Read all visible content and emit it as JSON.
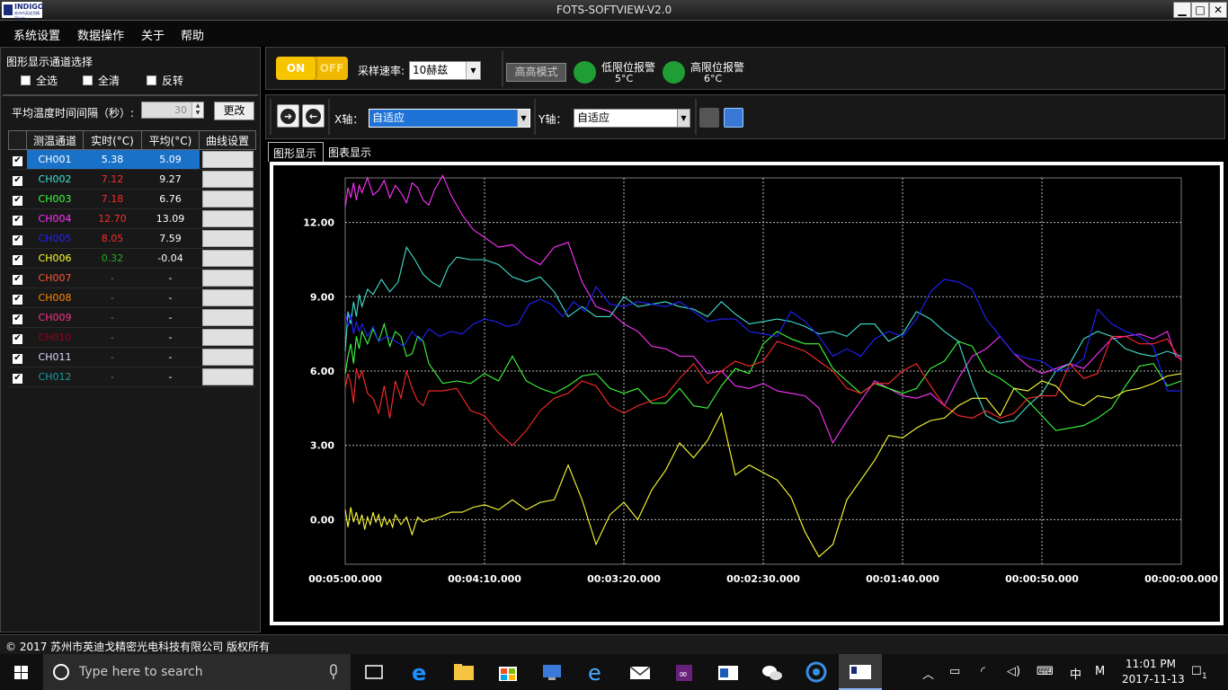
{
  "window": {
    "title": "FOTS-SOFTVIEW-V2.0",
    "logo_text": "INDIGO",
    "logo_sub": "苏州市英迪戈精密光电"
  },
  "menu": [
    "系统设置",
    "数据操作",
    "关于",
    "帮助"
  ],
  "left": {
    "channel_select_title": "图形显示通道选择",
    "options": [
      "全选",
      "全清",
      "反转"
    ],
    "interval_label": "平均温度时间间隔（秒）:",
    "interval_value": "30",
    "change_button": "更改",
    "table_headers": [
      "测温通道",
      "实时(°C)",
      "平均(°C)",
      "曲线设置"
    ],
    "channels": [
      {
        "name": "CH001",
        "rt": "5.38",
        "avg": "5.09",
        "color": "#ffffff",
        "rt_color": "#ffffff"
      },
      {
        "name": "CH002",
        "rt": "7.12",
        "avg": "9.27",
        "color": "#40e0d0",
        "rt_color": "#ff2a2a"
      },
      {
        "name": "CH003",
        "rt": "7.18",
        "avg": "6.76",
        "color": "#3cff3c",
        "rt_color": "#ff2a2a"
      },
      {
        "name": "CH004",
        "rt": "12.70",
        "avg": "13.09",
        "color": "#ff33ff",
        "rt_color": "#ff2a2a"
      },
      {
        "name": "CH005",
        "rt": "8.05",
        "avg": "7.59",
        "color": "#2222ff",
        "rt_color": "#ff2a2a"
      },
      {
        "name": "CH006",
        "rt": "0.32",
        "avg": "-0.04",
        "color": "#ffff33",
        "rt_color": "#22aa22"
      },
      {
        "name": "CH007",
        "rt": "-",
        "avg": "-",
        "color": "#ff5533",
        "rt_color": "#777777"
      },
      {
        "name": "CH008",
        "rt": "-",
        "avg": "-",
        "color": "#ff8800",
        "rt_color": "#777777"
      },
      {
        "name": "CH009",
        "rt": "-",
        "avg": "-",
        "color": "#ff3388",
        "rt_color": "#777777"
      },
      {
        "name": "CH010",
        "rt": "-",
        "avg": "-",
        "color": "#990022",
        "rt_color": "#777777"
      },
      {
        "name": "CH011",
        "rt": "-",
        "avg": "-",
        "color": "#ddddff",
        "rt_color": "#777777"
      },
      {
        "name": "CH012",
        "rt": "-",
        "avg": "-",
        "color": "#199999",
        "rt_color": "#777777"
      }
    ]
  },
  "controls": {
    "toggle_on": "ON",
    "toggle_off": "OFF",
    "rate_label": "采样速率:",
    "rate_value": "10赫兹",
    "high_speed_mode": "高高模式",
    "low_alarm_label": "低限位报警",
    "low_alarm_value": "5°C",
    "high_alarm_label": "高限位报警",
    "high_alarm_value": "6°C"
  },
  "chart_toolbar": {
    "x_axis_label": "X轴：",
    "x_axis_value": "自适应",
    "y_axis_label": "Y轴：",
    "y_axis_value": "自适应"
  },
  "tabs": [
    "图形显示",
    "图表显示"
  ],
  "chart_data": {
    "type": "line",
    "x_tick_labels": [
      "00:05:00.000",
      "00:04:10.000",
      "00:03:20.000",
      "00:02:30.000",
      "00:01:40.000",
      "00:00:50.000",
      "00:00:00.000"
    ],
    "y_tick_labels": [
      "0.00",
      "3.00",
      "6.00",
      "9.00",
      "12.00"
    ],
    "ylim": [
      -1.8,
      13.8
    ],
    "xlim": [
      300,
      0
    ],
    "grid": true,
    "series": [
      {
        "color": "#ff33ff",
        "x": [
          300,
          299,
          298,
          297,
          296,
          295,
          294,
          292,
          290,
          288,
          286,
          284,
          282,
          280,
          278,
          276,
          274,
          272,
          270,
          268,
          265,
          262,
          258,
          254,
          250,
          245,
          240,
          235,
          230,
          225,
          220,
          215,
          210,
          205,
          200,
          195,
          190,
          185,
          180,
          175,
          170,
          165,
          160,
          155,
          150,
          145,
          140,
          135,
          130,
          125,
          120,
          115,
          110,
          105,
          100,
          95,
          90,
          85,
          80,
          75,
          70,
          65,
          60,
          55,
          50,
          45,
          40,
          35,
          30,
          25,
          20,
          15,
          10,
          5,
          2,
          0
        ],
        "y": [
          12.6,
          13.4,
          13.0,
          13.6,
          12.9,
          13.5,
          13.2,
          13.8,
          13.1,
          13.3,
          13.7,
          13.0,
          13.5,
          13.2,
          12.8,
          13.6,
          13.4,
          12.9,
          12.7,
          13.3,
          13.9,
          13.1,
          12.3,
          11.7,
          11.4,
          11.0,
          11.1,
          10.6,
          10.3,
          11.0,
          11.2,
          9.6,
          8.6,
          8.4,
          7.9,
          7.6,
          7.0,
          6.9,
          6.6,
          6.6,
          5.9,
          6.0,
          5.4,
          5.3,
          5.5,
          5.2,
          5.1,
          5.0,
          4.5,
          3.1,
          4.0,
          4.8,
          5.6,
          5.3,
          5.0,
          4.9,
          5.1,
          4.6,
          5.7,
          6.6,
          6.9,
          7.4,
          6.7,
          6.2,
          5.9,
          6.1,
          6.3,
          6.1,
          6.7,
          7.3,
          7.4,
          7.5,
          7.3,
          7.6,
          6.6,
          6.5
        ]
      },
      {
        "color": "#40e0d0",
        "x": [
          300,
          299,
          298,
          297,
          296,
          295,
          294,
          292,
          290,
          287,
          284,
          281,
          278,
          275,
          272,
          269,
          266,
          263,
          260,
          255,
          250,
          245,
          240,
          235,
          230,
          225,
          220,
          215,
          210,
          205,
          200,
          195,
          190,
          185,
          180,
          175,
          170,
          165,
          160,
          155,
          150,
          145,
          140,
          135,
          130,
          125,
          120,
          115,
          110,
          105,
          100,
          95,
          90,
          85,
          80,
          75,
          70,
          65,
          60,
          55,
          50,
          45,
          40,
          35,
          30,
          25,
          20,
          15,
          10,
          5,
          0
        ],
        "y": [
          6.8,
          8.4,
          7.9,
          8.8,
          8.2,
          9.1,
          8.6,
          9.3,
          9.1,
          9.7,
          9.2,
          9.6,
          11.0,
          10.5,
          9.9,
          9.6,
          9.4,
          10.2,
          10.6,
          10.5,
          10.5,
          10.3,
          9.8,
          9.6,
          9.8,
          9.2,
          8.2,
          8.6,
          8.2,
          8.2,
          9.0,
          8.6,
          8.7,
          8.8,
          8.6,
          8.5,
          8.2,
          8.8,
          8.3,
          7.9,
          8.0,
          8.1,
          8.0,
          7.8,
          7.5,
          7.6,
          7.4,
          7.9,
          7.9,
          7.2,
          7.5,
          8.4,
          8.1,
          7.6,
          7.2,
          5.5,
          4.2,
          3.9,
          4.0,
          4.6,
          5.1,
          6.0,
          6.3,
          7.3,
          7.6,
          7.4,
          6.9,
          6.7,
          6.6,
          6.8,
          6.6
        ]
      },
      {
        "color": "#3cff3c",
        "x": [
          300,
          299,
          298,
          297,
          296,
          295,
          294,
          292,
          290,
          288,
          286,
          284,
          282,
          280,
          278,
          276,
          274,
          272,
          270,
          265,
          260,
          255,
          250,
          245,
          240,
          235,
          230,
          225,
          220,
          215,
          210,
          205,
          200,
          195,
          190,
          185,
          180,
          175,
          170,
          165,
          160,
          155,
          150,
          145,
          140,
          135,
          130,
          125,
          120,
          115,
          110,
          105,
          100,
          95,
          90,
          85,
          80,
          75,
          70,
          65,
          60,
          55,
          50,
          45,
          40,
          35,
          30,
          25,
          20,
          15,
          10,
          5,
          0
        ],
        "y": [
          5.9,
          6.6,
          7.1,
          6.3,
          7.4,
          6.9,
          7.6,
          7.1,
          7.7,
          7.2,
          7.9,
          7.0,
          7.6,
          7.4,
          6.6,
          6.7,
          7.4,
          7.2,
          6.3,
          5.5,
          5.6,
          5.5,
          5.9,
          5.6,
          6.6,
          5.6,
          5.3,
          5.1,
          5.4,
          5.8,
          5.9,
          5.3,
          5.1,
          5.3,
          4.7,
          4.7,
          5.3,
          4.6,
          4.5,
          5.4,
          6.1,
          5.9,
          7.1,
          7.6,
          7.3,
          7.1,
          7.1,
          6.1,
          5.6,
          5.1,
          5.5,
          5.3,
          5.1,
          5.3,
          6.1,
          6.4,
          7.2,
          7.0,
          6.0,
          5.7,
          5.3,
          4.8,
          4.2,
          3.6,
          3.7,
          3.8,
          4.1,
          4.5,
          5.4,
          6.2,
          6.3,
          5.4,
          5.6
        ]
      },
      {
        "color": "#2222ff",
        "x": [
          300,
          299,
          298,
          297,
          296,
          295,
          294,
          292,
          290,
          288,
          285,
          282,
          279,
          276,
          273,
          270,
          266,
          262,
          258,
          254,
          250,
          246,
          242,
          238,
          234,
          230,
          226,
          222,
          218,
          214,
          210,
          205,
          200,
          195,
          190,
          185,
          180,
          175,
          170,
          165,
          160,
          155,
          150,
          145,
          140,
          135,
          130,
          125,
          120,
          115,
          110,
          105,
          100,
          95,
          90,
          85,
          80,
          75,
          70,
          65,
          60,
          55,
          50,
          45,
          40,
          35,
          30,
          25,
          20,
          15,
          10,
          5,
          0
        ],
        "y": [
          8.4,
          7.8,
          8.3,
          7.5,
          8.0,
          7.6,
          7.9,
          7.4,
          7.8,
          7.2,
          7.4,
          7.2,
          7.0,
          7.6,
          7.2,
          7.7,
          7.4,
          7.6,
          7.5,
          7.9,
          8.1,
          8.0,
          7.8,
          7.9,
          8.7,
          8.9,
          8.7,
          8.2,
          8.8,
          8.4,
          9.4,
          8.7,
          8.6,
          8.8,
          8.7,
          8.6,
          8.8,
          8.4,
          8.0,
          8.1,
          8.1,
          7.6,
          7.5,
          7.4,
          8.4,
          8.0,
          7.4,
          6.6,
          6.9,
          6.6,
          7.3,
          7.6,
          7.4,
          8.1,
          9.2,
          9.7,
          9.6,
          9.3,
          8.1,
          7.4,
          6.7,
          6.5,
          6.4,
          6.0,
          6.1,
          6.5,
          8.5,
          7.9,
          7.6,
          7.4,
          7.0,
          5.2,
          5.2
        ]
      },
      {
        "color": "#ff2a2a",
        "x": [
          300,
          299,
          298,
          297,
          296,
          295,
          294,
          292,
          290,
          288,
          286,
          284,
          282,
          280,
          278,
          276,
          274,
          272,
          270,
          265,
          260,
          255,
          250,
          245,
          240,
          235,
          230,
          225,
          220,
          215,
          210,
          205,
          200,
          195,
          190,
          185,
          180,
          175,
          170,
          165,
          160,
          155,
          150,
          145,
          140,
          135,
          130,
          125,
          120,
          115,
          110,
          105,
          100,
          95,
          90,
          85,
          80,
          75,
          70,
          65,
          60,
          55,
          50,
          45,
          40,
          35,
          30,
          25,
          20,
          15,
          10,
          5,
          0
        ],
        "y": [
          5.3,
          5.9,
          5.5,
          4.7,
          6.1,
          5.7,
          6.0,
          5.1,
          4.9,
          4.3,
          5.4,
          4.1,
          5.6,
          4.9,
          6.0,
          5.3,
          4.8,
          4.6,
          5.2,
          5.2,
          5.3,
          4.4,
          4.2,
          3.5,
          3.0,
          3.6,
          4.4,
          4.9,
          5.1,
          5.6,
          5.4,
          4.6,
          4.3,
          4.6,
          4.8,
          5.0,
          5.7,
          6.3,
          5.5,
          6.0,
          6.4,
          6.2,
          6.4,
          7.2,
          7.0,
          6.8,
          6.4,
          6.0,
          5.3,
          5.1,
          5.5,
          5.5,
          6.0,
          6.3,
          5.4,
          4.6,
          4.2,
          4.1,
          4.4,
          4.1,
          4.3,
          4.9,
          5.0,
          5.0,
          6.3,
          5.7,
          5.9,
          7.4,
          7.4,
          7.1,
          7.1,
          7.3,
          6.4
        ]
      },
      {
        "color": "#ffff33",
        "x": [
          300,
          299,
          298,
          297,
          296,
          295,
          294,
          293,
          292,
          291,
          290,
          289,
          288,
          287,
          286,
          285,
          284,
          283,
          282,
          280,
          278,
          276,
          274,
          272,
          270,
          266,
          262,
          258,
          254,
          250,
          245,
          240,
          235,
          230,
          225,
          220,
          215,
          210,
          205,
          200,
          195,
          190,
          185,
          180,
          175,
          170,
          165,
          160,
          155,
          150,
          145,
          140,
          135,
          130,
          125,
          120,
          115,
          110,
          105,
          100,
          95,
          90,
          85,
          80,
          75,
          70,
          65,
          60,
          55,
          50,
          45,
          40,
          35,
          30,
          25,
          20,
          15,
          10,
          5,
          0
        ],
        "y": [
          0.4,
          -0.3,
          0.5,
          -0.1,
          0.3,
          -0.2,
          0.2,
          -0.4,
          0.1,
          -0.2,
          0.3,
          -0.1,
          0.2,
          -0.3,
          0.1,
          -0.2,
          0.0,
          -0.3,
          0.2,
          -0.2,
          0.1,
          -0.6,
          0.1,
          -0.1,
          0.0,
          0.1,
          0.3,
          0.3,
          0.5,
          0.6,
          0.4,
          0.8,
          0.4,
          0.7,
          0.8,
          2.2,
          0.8,
          -1.0,
          0.2,
          0.7,
          0.0,
          1.2,
          2.0,
          3.1,
          2.5,
          3.2,
          4.3,
          1.8,
          2.2,
          1.9,
          1.6,
          0.9,
          -0.5,
          -1.5,
          -1.0,
          0.8,
          1.6,
          2.4,
          3.4,
          3.3,
          3.7,
          4.0,
          4.1,
          4.6,
          4.9,
          4.9,
          4.2,
          5.3,
          5.2,
          5.6,
          5.4,
          4.8,
          4.6,
          5.0,
          4.9,
          5.2,
          5.3,
          5.5,
          5.8,
          5.9
        ]
      }
    ]
  },
  "footer": {
    "copyright": "©  2017 苏州市英迪戈精密光电科技有限公司  版权所有"
  },
  "taskbar": {
    "search_placeholder": "Type here to search",
    "ime": "中",
    "ime2": "M",
    "time": "11:01 PM",
    "date": "2017-11-13",
    "notification_count": "1"
  }
}
